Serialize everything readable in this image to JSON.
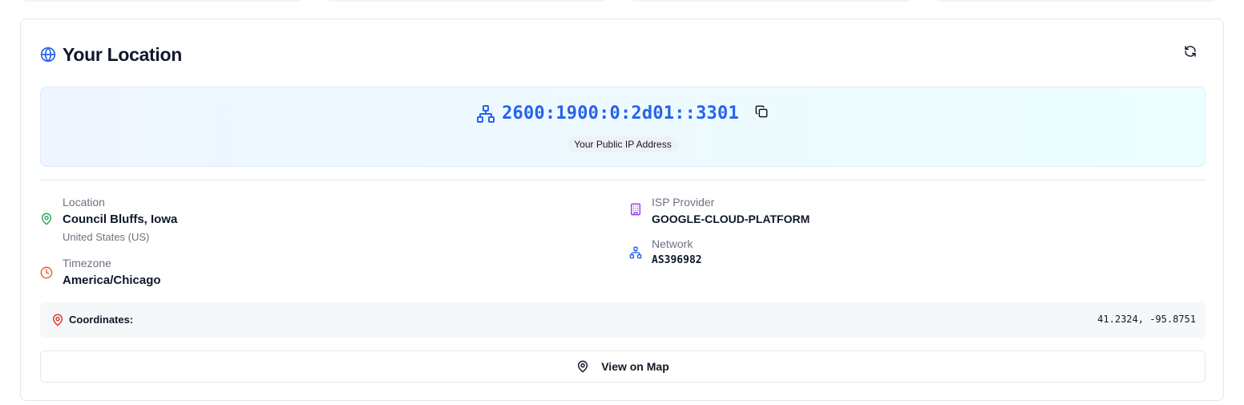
{
  "card": {
    "title": "Your Location",
    "icons": {
      "title": "globe-icon",
      "refresh": "refresh-icon"
    }
  },
  "ip": {
    "address": "2600:1900:0:2d01::3301",
    "label": "Your Public IP Address",
    "icons": {
      "network": "network-icon",
      "copy": "copy-icon"
    }
  },
  "details": {
    "location": {
      "label": "Location",
      "value": "Council Bluffs, Iowa",
      "country": "United States (US)",
      "icon": "map-pin-icon"
    },
    "timezone": {
      "label": "Timezone",
      "value": "America/Chicago",
      "icon": "clock-icon"
    },
    "isp": {
      "label": "ISP Provider",
      "value": "GOOGLE-CLOUD-PLATFORM",
      "icon": "building-icon"
    },
    "network": {
      "label": "Network",
      "value": "AS396982",
      "icon": "network-icon"
    }
  },
  "coordinates": {
    "label": "Coordinates:",
    "value": "41.2324, -95.8751",
    "icon": "map-pin-icon"
  },
  "map_button": {
    "label": "View on Map",
    "icon": "map-pin-icon"
  },
  "colors": {
    "accent_blue": "#2563eb",
    "location_green": "#16a34a",
    "timezone_orange": "#ea580c",
    "isp_purple": "#9333ea",
    "coords_red": "#dc2626"
  }
}
